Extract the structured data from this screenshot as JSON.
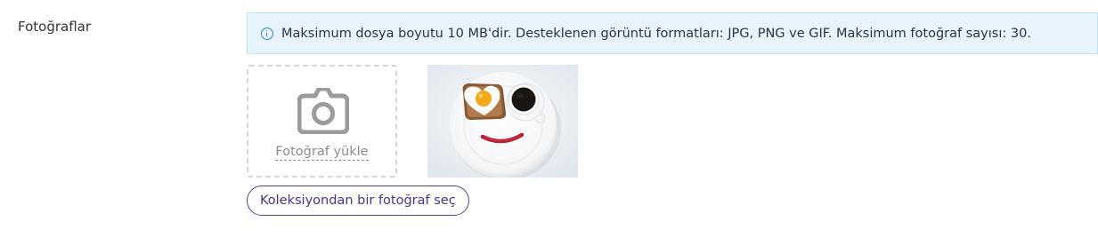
{
  "field": {
    "label": "Fotoğraflar"
  },
  "info": {
    "icon": "info-icon",
    "message": "Maksimum dosya boyutu 10 MB'dir. Desteklenen görüntü formatları: JPG, PNG ve GIF. Maksimum fotoğraf sayısı: 30."
  },
  "upload": {
    "icon": "camera-icon",
    "label": "Fotoğraf yükle"
  },
  "photos": [
    {
      "subject": "breakfast-smiley-plate"
    }
  ],
  "actions": {
    "collection_label": "Koleksiyondan bir fotoğraf seç"
  },
  "colors": {
    "info_bg": "#e8f4fd",
    "info_border": "#c2e0f6",
    "info_icon": "#2f7fc7",
    "button_border": "#5a3e96",
    "button_text": "#4a3386",
    "muted": "#8c8c8c"
  }
}
